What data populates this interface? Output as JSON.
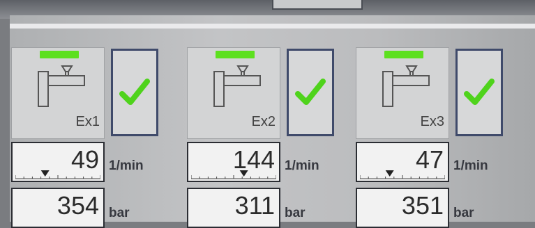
{
  "extruders": [
    {
      "label": "Ex1",
      "status": "ok",
      "speed": "49",
      "pressure": "354",
      "pointer_fraction": 0.35
    },
    {
      "label": "Ex2",
      "status": "ok",
      "speed": "144",
      "pressure": "311",
      "pointer_fraction": 0.62
    },
    {
      "label": "Ex3",
      "status": "ok",
      "speed": "47",
      "pressure": "351",
      "pointer_fraction": 0.35
    }
  ],
  "units": {
    "speed": "1/min",
    "pressure": "bar"
  },
  "icons": {
    "extruder": "extruder-icon",
    "check": "checkmark-icon",
    "pointer": "pointer-triangle-icon"
  },
  "colors": {
    "status_led": "#5de01f",
    "check": "#4fd31c"
  }
}
